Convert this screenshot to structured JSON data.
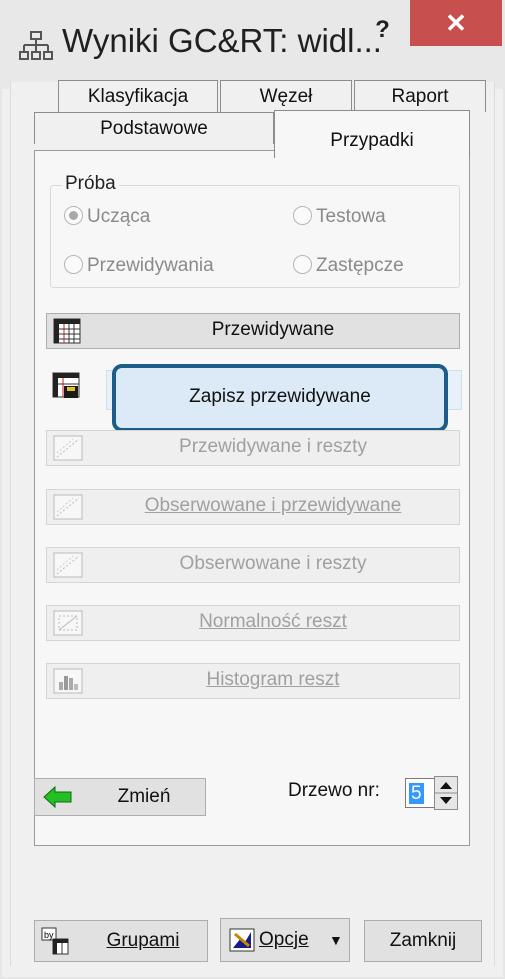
{
  "window": {
    "title": "Wyniki GC&RT: widl...",
    "help": "?",
    "close": "✕"
  },
  "tabs_back": [
    "Klasyfikacja",
    "Węzeł",
    "Raport"
  ],
  "tabs_front": [
    "Podstawowe",
    "Przypadki"
  ],
  "group": {
    "label": "Próba",
    "radios": [
      {
        "label": "Ucząca",
        "checked": true
      },
      {
        "label": "Testowa",
        "checked": false
      },
      {
        "label": "Przewidywania",
        "checked": false
      },
      {
        "label": "Zastępcze",
        "checked": false
      }
    ]
  },
  "buttons": {
    "predicted": "Przewidywane",
    "save_predicted": "Zapisz przewidywane",
    "predicted_residuals": "Przewidywane i reszty",
    "observed_predicted": "Obserwowane i przewidywane",
    "observed_residuals": "Obserwowane i reszty",
    "normality": "Normalność reszt",
    "histogram": "Histogram reszt"
  },
  "footer": {
    "change": "Zmień",
    "tree_label": "Drzewo nr:",
    "tree_value": "5",
    "groups": "Grupami",
    "options": "Opcje",
    "close": "Zamknij"
  },
  "colors": {
    "accent": "#1b5c8a",
    "close_red": "#c7504f",
    "arrow_green": "#22c022"
  }
}
